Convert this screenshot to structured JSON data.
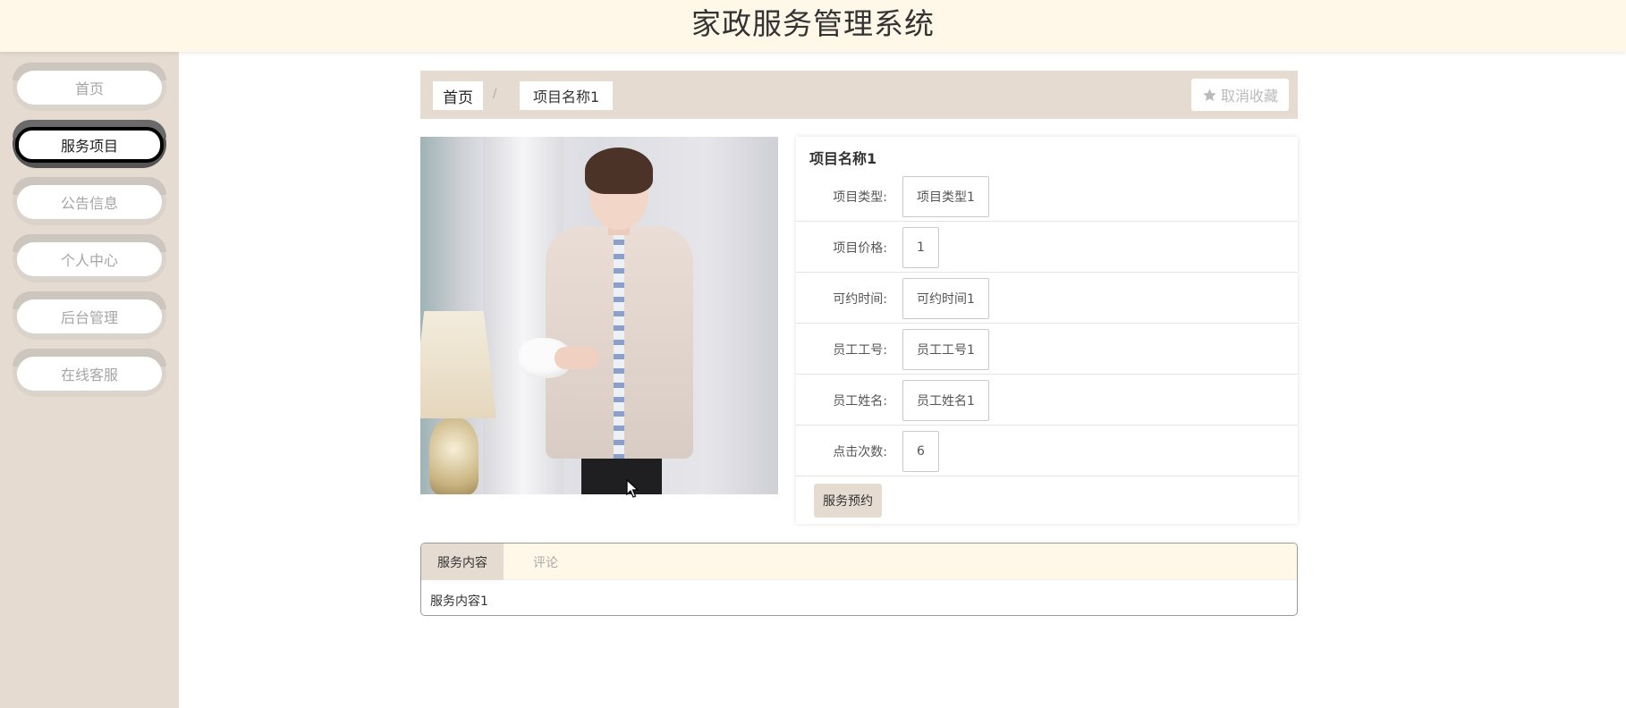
{
  "header": {
    "title": "家政服务管理系统"
  },
  "sidebar": {
    "items": [
      {
        "label": "首页",
        "active": false
      },
      {
        "label": "服务项目",
        "active": true
      },
      {
        "label": "公告信息",
        "active": false
      },
      {
        "label": "个人中心",
        "active": false
      },
      {
        "label": "后台管理",
        "active": false
      },
      {
        "label": "在线客服",
        "active": false
      }
    ]
  },
  "breadcrumb": {
    "home": "首页",
    "separator": "/",
    "current": "项目名称1"
  },
  "favorite": {
    "label": "取消收藏",
    "icon": "star-icon"
  },
  "detail": {
    "title": "项目名称1",
    "fields": [
      {
        "label": "项目类型:",
        "value": "项目类型1"
      },
      {
        "label": "项目价格:",
        "value": "1"
      },
      {
        "label": "可约时间:",
        "value": "可约时间1"
      },
      {
        "label": "员工工号:",
        "value": "员工工号1"
      },
      {
        "label": "员工姓名:",
        "value": "员工姓名1"
      },
      {
        "label": "点击次数:",
        "value": "6"
      }
    ],
    "book_button": "服务预约"
  },
  "tabs": {
    "items": [
      {
        "label": "服务内容",
        "active": true
      },
      {
        "label": "评论",
        "active": false
      }
    ],
    "content": "服务内容1"
  },
  "colors": {
    "header_bg": "#fff8e8",
    "sidebar_bg": "#e6dbd1",
    "accent": "#e6dbd1"
  }
}
